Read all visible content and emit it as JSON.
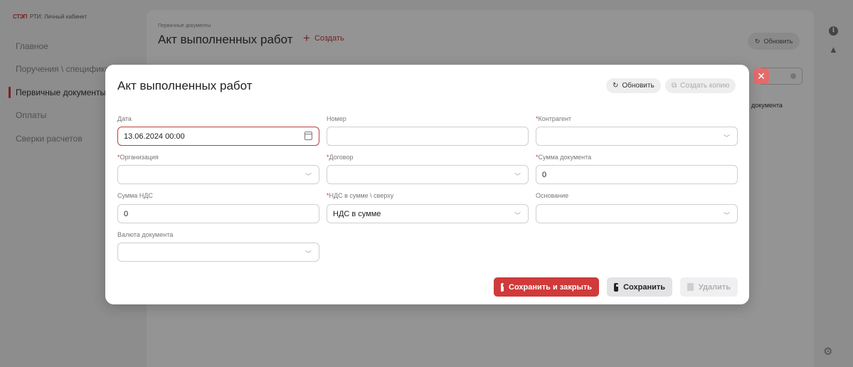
{
  "brand": {
    "logo": "СТЭП",
    "name": "РТИ: Личный кабинет"
  },
  "sidebar": {
    "items": [
      {
        "label": "Главное"
      },
      {
        "label": "Поручения \\ спецификации"
      },
      {
        "label": "Первичные документы"
      },
      {
        "label": "Оплаты"
      },
      {
        "label": "Сверки расчетов"
      }
    ]
  },
  "page": {
    "breadcrumb": "Первичные документы",
    "title": "Акт выполненных работ",
    "create_label": "Создать",
    "refresh_label": "Обновить",
    "column_fragment": "документа"
  },
  "modal": {
    "title": "Акт выполненных работ",
    "refresh_label": "Обновить",
    "copy_label": "Создать копию",
    "fields": {
      "date": {
        "label": "Дата",
        "value": "13.06.2024 00:00"
      },
      "number": {
        "label": "Номер",
        "value": ""
      },
      "counterparty": {
        "label": "Контрагент",
        "required": "*",
        "value": ""
      },
      "organization": {
        "label": "Организация",
        "required": "*",
        "value": ""
      },
      "contract": {
        "label": "Договор",
        "required": "*",
        "value": ""
      },
      "amount": {
        "label": "Сумма документа",
        "required": "*",
        "value": "0"
      },
      "vat_amount": {
        "label": "Сумма НДС",
        "value": "0"
      },
      "vat_mode": {
        "label": "НДС в сумме \\ сверху",
        "required": "*",
        "value": "НДС в сумме"
      },
      "basis": {
        "label": "Основание",
        "value": ""
      },
      "currency": {
        "label": "Валюта документа",
        "value": ""
      }
    },
    "buttons": {
      "save_close": "Сохранить и закрыть",
      "save": "Сохранить",
      "delete": "Удалить"
    }
  },
  "colors": {
    "accent": "#d03a3a",
    "close": "#e56b6b",
    "overlay": "rgba(0,0,0,0.42)"
  },
  "icons": [
    "refresh-icon",
    "plus-icon",
    "close-icon",
    "calendar-icon",
    "chevron-down-icon",
    "copy-icon",
    "save-icon",
    "trash-icon",
    "info-icon",
    "bell-icon",
    "gear-icon"
  ]
}
